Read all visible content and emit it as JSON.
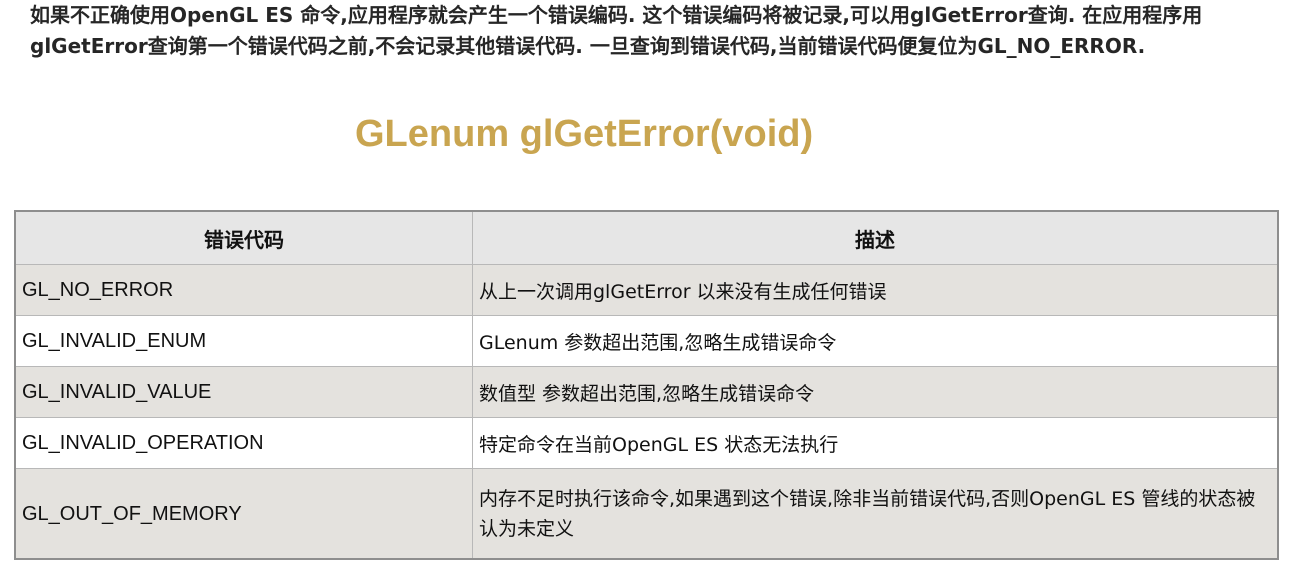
{
  "intro": {
    "text": "如果不正确使用OpenGL ES 命令,应用程序就会产生一个错误编码. 这个错误编码将被记录,可以用glGetError查询. 在应用程序用glGetError查询第一个错误代码之前,不会记录其他错误代码. 一旦查询到错误代码,当前错误代码便复位为GL_NO_ERROR."
  },
  "function_signature": "GLenum glGetError(void)",
  "table": {
    "headers": [
      "错误代码",
      "描述"
    ],
    "rows": [
      {
        "code": "GL_NO_ERROR",
        "description": "从上一次调用glGetError 以来没有生成任何错误"
      },
      {
        "code": "GL_INVALID_ENUM",
        "description": "GLenum 参数超出范围,忽略生成错误命令"
      },
      {
        "code": "GL_INVALID_VALUE",
        "description": "数值型 参数超出范围,忽略生成错误命令"
      },
      {
        "code": "GL_INVALID_OPERATION",
        "description": "特定命令在当前OpenGL ES 状态无法执行"
      },
      {
        "code": "GL_OUT_OF_MEMORY",
        "description": "内存不足时执行该命令,如果遇到这个错误,除非当前错误代码,否则OpenGL ES 管线的状态被认为未定义"
      }
    ]
  }
}
